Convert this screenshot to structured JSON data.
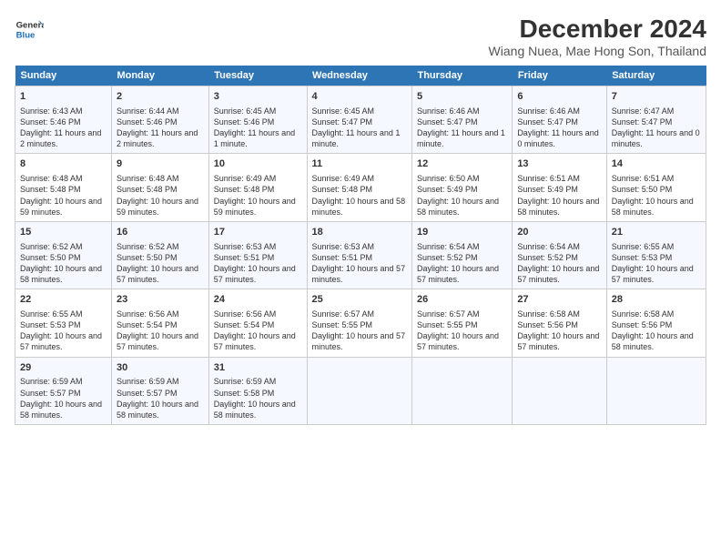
{
  "header": {
    "logo_line1": "General",
    "logo_line2": "Blue",
    "title": "December 2024",
    "subtitle": "Wiang Nuea, Mae Hong Son, Thailand"
  },
  "calendar": {
    "days_of_week": [
      "Sunday",
      "Monday",
      "Tuesday",
      "Wednesday",
      "Thursday",
      "Friday",
      "Saturday"
    ],
    "weeks": [
      [
        {
          "day": "1",
          "info": "Sunrise: 6:43 AM\nSunset: 5:46 PM\nDaylight: 11 hours and 2 minutes."
        },
        {
          "day": "2",
          "info": "Sunrise: 6:44 AM\nSunset: 5:46 PM\nDaylight: 11 hours and 2 minutes."
        },
        {
          "day": "3",
          "info": "Sunrise: 6:45 AM\nSunset: 5:46 PM\nDaylight: 11 hours and 1 minute."
        },
        {
          "day": "4",
          "info": "Sunrise: 6:45 AM\nSunset: 5:47 PM\nDaylight: 11 hours and 1 minute."
        },
        {
          "day": "5",
          "info": "Sunrise: 6:46 AM\nSunset: 5:47 PM\nDaylight: 11 hours and 1 minute."
        },
        {
          "day": "6",
          "info": "Sunrise: 6:46 AM\nSunset: 5:47 PM\nDaylight: 11 hours and 0 minutes."
        },
        {
          "day": "7",
          "info": "Sunrise: 6:47 AM\nSunset: 5:47 PM\nDaylight: 11 hours and 0 minutes."
        }
      ],
      [
        {
          "day": "8",
          "info": "Sunrise: 6:48 AM\nSunset: 5:48 PM\nDaylight: 10 hours and 59 minutes."
        },
        {
          "day": "9",
          "info": "Sunrise: 6:48 AM\nSunset: 5:48 PM\nDaylight: 10 hours and 59 minutes."
        },
        {
          "day": "10",
          "info": "Sunrise: 6:49 AM\nSunset: 5:48 PM\nDaylight: 10 hours and 59 minutes."
        },
        {
          "day": "11",
          "info": "Sunrise: 6:49 AM\nSunset: 5:48 PM\nDaylight: 10 hours and 58 minutes."
        },
        {
          "day": "12",
          "info": "Sunrise: 6:50 AM\nSunset: 5:49 PM\nDaylight: 10 hours and 58 minutes."
        },
        {
          "day": "13",
          "info": "Sunrise: 6:51 AM\nSunset: 5:49 PM\nDaylight: 10 hours and 58 minutes."
        },
        {
          "day": "14",
          "info": "Sunrise: 6:51 AM\nSunset: 5:50 PM\nDaylight: 10 hours and 58 minutes."
        }
      ],
      [
        {
          "day": "15",
          "info": "Sunrise: 6:52 AM\nSunset: 5:50 PM\nDaylight: 10 hours and 58 minutes."
        },
        {
          "day": "16",
          "info": "Sunrise: 6:52 AM\nSunset: 5:50 PM\nDaylight: 10 hours and 57 minutes."
        },
        {
          "day": "17",
          "info": "Sunrise: 6:53 AM\nSunset: 5:51 PM\nDaylight: 10 hours and 57 minutes."
        },
        {
          "day": "18",
          "info": "Sunrise: 6:53 AM\nSunset: 5:51 PM\nDaylight: 10 hours and 57 minutes."
        },
        {
          "day": "19",
          "info": "Sunrise: 6:54 AM\nSunset: 5:52 PM\nDaylight: 10 hours and 57 minutes."
        },
        {
          "day": "20",
          "info": "Sunrise: 6:54 AM\nSunset: 5:52 PM\nDaylight: 10 hours and 57 minutes."
        },
        {
          "day": "21",
          "info": "Sunrise: 6:55 AM\nSunset: 5:53 PM\nDaylight: 10 hours and 57 minutes."
        }
      ],
      [
        {
          "day": "22",
          "info": "Sunrise: 6:55 AM\nSunset: 5:53 PM\nDaylight: 10 hours and 57 minutes."
        },
        {
          "day": "23",
          "info": "Sunrise: 6:56 AM\nSunset: 5:54 PM\nDaylight: 10 hours and 57 minutes."
        },
        {
          "day": "24",
          "info": "Sunrise: 6:56 AM\nSunset: 5:54 PM\nDaylight: 10 hours and 57 minutes."
        },
        {
          "day": "25",
          "info": "Sunrise: 6:57 AM\nSunset: 5:55 PM\nDaylight: 10 hours and 57 minutes."
        },
        {
          "day": "26",
          "info": "Sunrise: 6:57 AM\nSunset: 5:55 PM\nDaylight: 10 hours and 57 minutes."
        },
        {
          "day": "27",
          "info": "Sunrise: 6:58 AM\nSunset: 5:56 PM\nDaylight: 10 hours and 57 minutes."
        },
        {
          "day": "28",
          "info": "Sunrise: 6:58 AM\nSunset: 5:56 PM\nDaylight: 10 hours and 58 minutes."
        }
      ],
      [
        {
          "day": "29",
          "info": "Sunrise: 6:59 AM\nSunset: 5:57 PM\nDaylight: 10 hours and 58 minutes."
        },
        {
          "day": "30",
          "info": "Sunrise: 6:59 AM\nSunset: 5:57 PM\nDaylight: 10 hours and 58 minutes."
        },
        {
          "day": "31",
          "info": "Sunrise: 6:59 AM\nSunset: 5:58 PM\nDaylight: 10 hours and 58 minutes."
        },
        {
          "day": "",
          "info": ""
        },
        {
          "day": "",
          "info": ""
        },
        {
          "day": "",
          "info": ""
        },
        {
          "day": "",
          "info": ""
        }
      ]
    ]
  }
}
